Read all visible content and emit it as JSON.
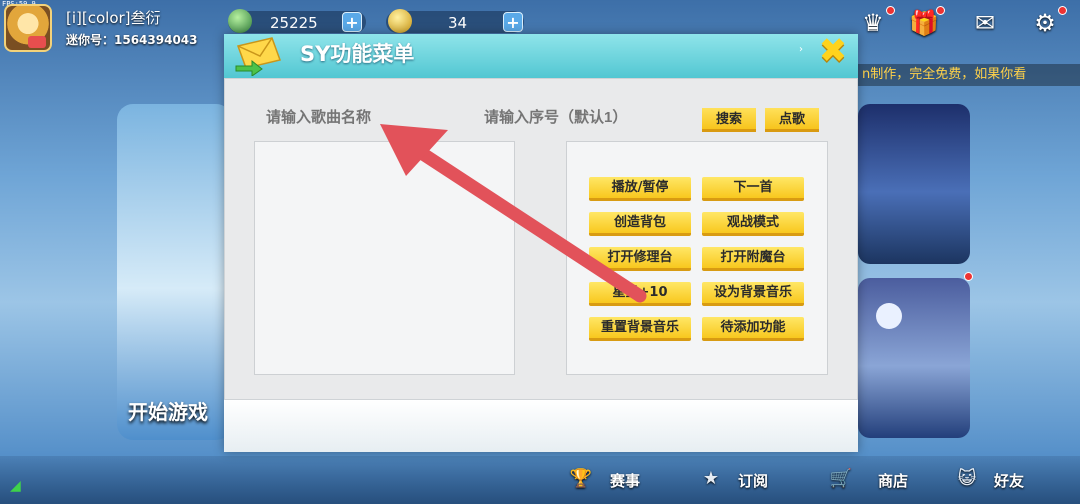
{
  "status": {
    "fps": "FPS:59.9"
  },
  "player": {
    "name": "[i][color]叁衍",
    "id_text": "迷你号：1564394043"
  },
  "currencies": [
    {
      "icon": "gem-icon",
      "value": "25225"
    },
    {
      "icon": "coin-icon",
      "value": "34"
    }
  ],
  "top_icons": [
    "crown-icon",
    "gift-icon",
    "mail-icon",
    "gear-icon"
  ],
  "marquee": "n制作，完全免费，如果你看",
  "background": {
    "left_card_label": "开始游戏"
  },
  "dialog": {
    "title": "SY功能菜单",
    "song_input_placeholder": "请输入歌曲名称",
    "index_input_placeholder": "请输入序号（默认1）",
    "search_button": "搜索",
    "play_song_button": "点歌",
    "functions": [
      [
        "播放/暂停",
        "下一首"
      ],
      [
        "创造背包",
        "观战模式"
      ],
      [
        "打开修理台",
        "打开附魔台"
      ],
      [
        "星星+10",
        "设为背景音乐"
      ],
      [
        "重置背景音乐",
        "待添加功能"
      ]
    ]
  },
  "bottom_nav": [
    {
      "icon": "trophy-icon",
      "label": "赛事"
    },
    {
      "icon": "star-icon",
      "label": "订阅"
    },
    {
      "icon": "cart-icon",
      "label": "商店"
    },
    {
      "icon": "cat-icon",
      "label": "好友"
    }
  ],
  "colors": {
    "dialog_header": "#52c7d2",
    "button_yellow": "#f8c81e",
    "annotation_arrow": "#e2525a"
  }
}
